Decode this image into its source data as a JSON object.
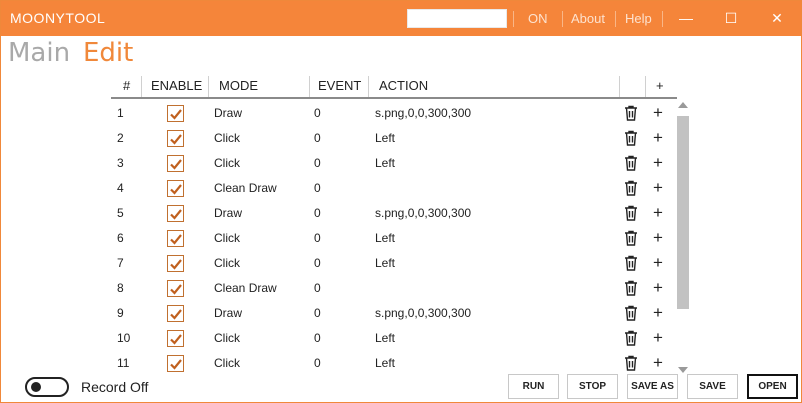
{
  "app": {
    "title": "MOONYTOOL",
    "search_value": "",
    "links": {
      "on": "ON",
      "about": "About",
      "help": "Help"
    },
    "window_controls": {
      "minimize": "—",
      "maximize": "☐",
      "close": "✕"
    }
  },
  "tabs": {
    "main": "Main",
    "edit": "Edit"
  },
  "table": {
    "headers": {
      "num": "#",
      "enable": "ENABLE",
      "mode": "MODE",
      "event": "EVENT",
      "action": "ACTION",
      "add": "+"
    },
    "rows": [
      {
        "num": "1",
        "enabled": true,
        "mode": "Draw",
        "event": "0",
        "action": "s.png,0,0,300,300"
      },
      {
        "num": "2",
        "enabled": true,
        "mode": "Click",
        "event": "0",
        "action": "Left"
      },
      {
        "num": "3",
        "enabled": true,
        "mode": "Click",
        "event": "0",
        "action": "Left"
      },
      {
        "num": "4",
        "enabled": true,
        "mode": "Clean Draw",
        "event": "0",
        "action": ""
      },
      {
        "num": "5",
        "enabled": true,
        "mode": "Draw",
        "event": "0",
        "action": "s.png,0,0,300,300"
      },
      {
        "num": "6",
        "enabled": true,
        "mode": "Click",
        "event": "0",
        "action": "Left"
      },
      {
        "num": "7",
        "enabled": true,
        "mode": "Click",
        "event": "0",
        "action": "Left"
      },
      {
        "num": "8",
        "enabled": true,
        "mode": "Clean Draw",
        "event": "0",
        "action": ""
      },
      {
        "num": "9",
        "enabled": true,
        "mode": "Draw",
        "event": "0",
        "action": "s.png,0,0,300,300"
      },
      {
        "num": "10",
        "enabled": true,
        "mode": "Click",
        "event": "0",
        "action": "Left"
      },
      {
        "num": "11",
        "enabled": true,
        "mode": "Click",
        "event": "0",
        "action": "Left"
      }
    ],
    "row_icons": {
      "delete": "trash-icon",
      "insert": "plus-icon"
    }
  },
  "footer": {
    "record_label": "Record Off",
    "record_on": false,
    "buttons": {
      "run": "RUN",
      "stop": "STOP",
      "save_as": "SAVE AS",
      "save": "SAVE",
      "open": "OPEN"
    }
  },
  "colors": {
    "accent": "#f5853a",
    "checkmark": "#c0601e"
  }
}
